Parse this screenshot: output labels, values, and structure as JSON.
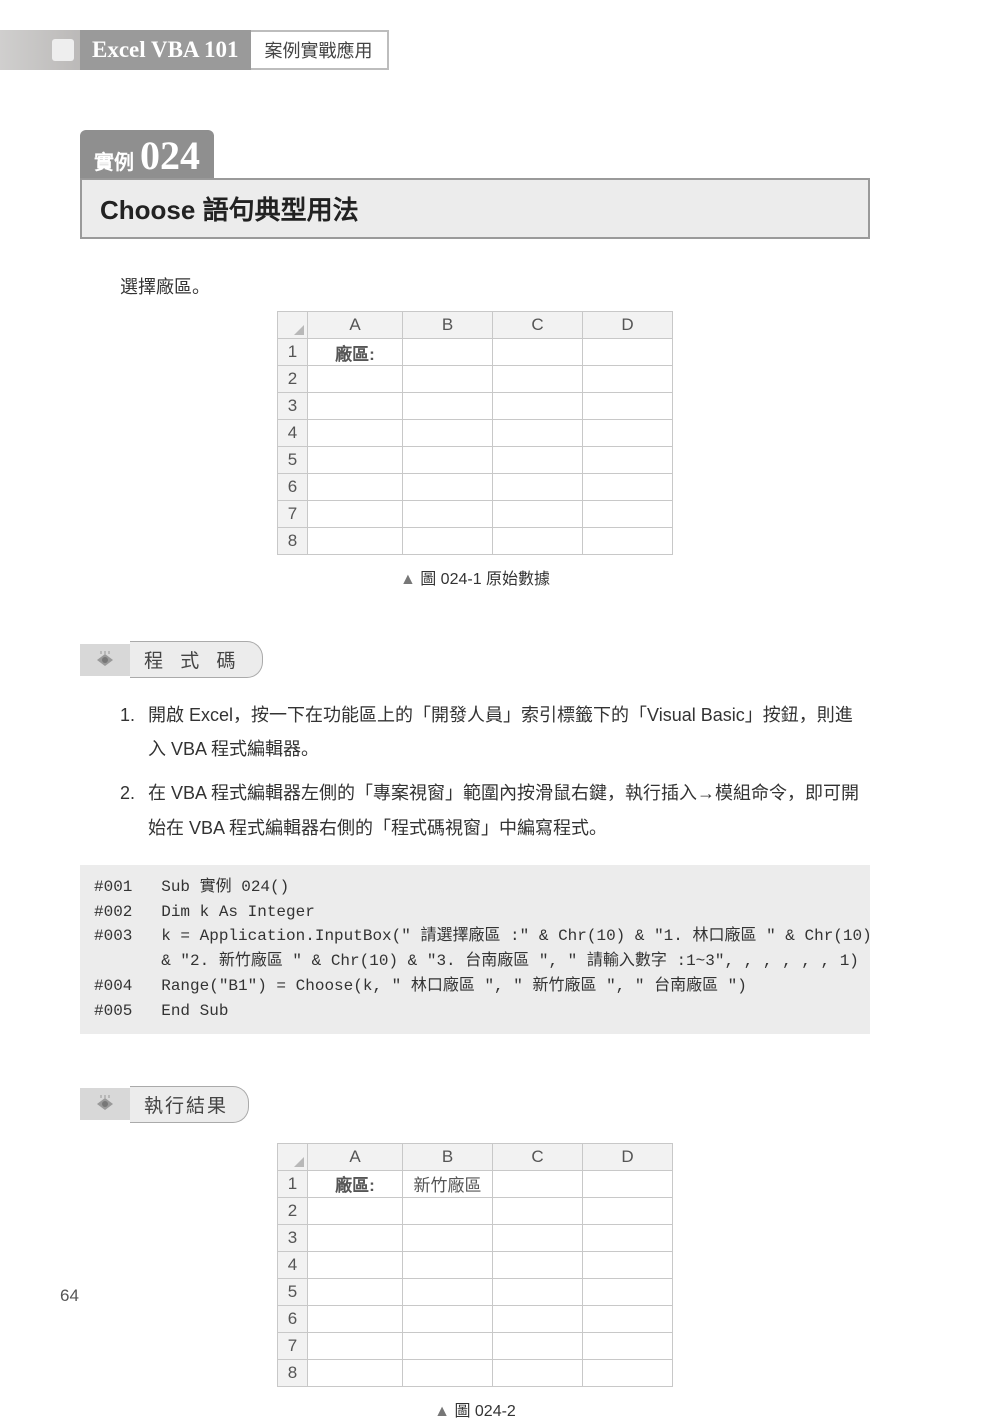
{
  "header": {
    "title": "Excel VBA 101",
    "subtitle": "案例實戰應用"
  },
  "example": {
    "label": "實例",
    "number": "024"
  },
  "page_title": "Choose 語句典型用法",
  "intro_text": "選擇廠區。",
  "table1": {
    "columns": [
      "A",
      "B",
      "C",
      "D"
    ],
    "rows": [
      "1",
      "2",
      "3",
      "4",
      "5",
      "6",
      "7",
      "8"
    ],
    "cells": {
      "A1": "廠區:"
    },
    "caption": "圖 024-1 原始數據"
  },
  "sections": {
    "code_label": "程 式 碼",
    "result_label": "執行結果"
  },
  "steps": [
    {
      "n": "1.",
      "t": "開啟 Excel，按一下在功能區上的「開發人員」索引標籤下的「Visual Basic」按鈕，則進入 VBA 程式編輯器。"
    },
    {
      "n": "2.",
      "t": "在 VBA 程式編輯器左側的「專案視窗」範圍內按滑鼠右鍵，執行插入→模組命令，即可開始在 VBA 程式編輯器右側的「程式碼視窗」中編寫程式。"
    }
  ],
  "code": "#001   Sub 實例 024()\n#002   Dim k As Integer\n#003   k = Application.InputBox(\" 請選擇廠區 :\" & Chr(10) & \"1. 林口廠區 \" & Chr(10)\n       & \"2. 新竹廠區 \" & Chr(10) & \"3. 台南廠區 \", \" 請輸入數字 :1~3\", , , , , , 1)\n#004   Range(\"B1\") = Choose(k, \" 林口廠區 \", \" 新竹廠區 \", \" 台南廠區 \")\n#005   End Sub",
  "table2": {
    "columns": [
      "A",
      "B",
      "C",
      "D"
    ],
    "rows": [
      "1",
      "2",
      "3",
      "4",
      "5",
      "6",
      "7",
      "8"
    ],
    "cells": {
      "A1": "廠區:",
      "B1": "新竹廠區"
    },
    "caption": "圖 024-2"
  },
  "page_number": "64"
}
